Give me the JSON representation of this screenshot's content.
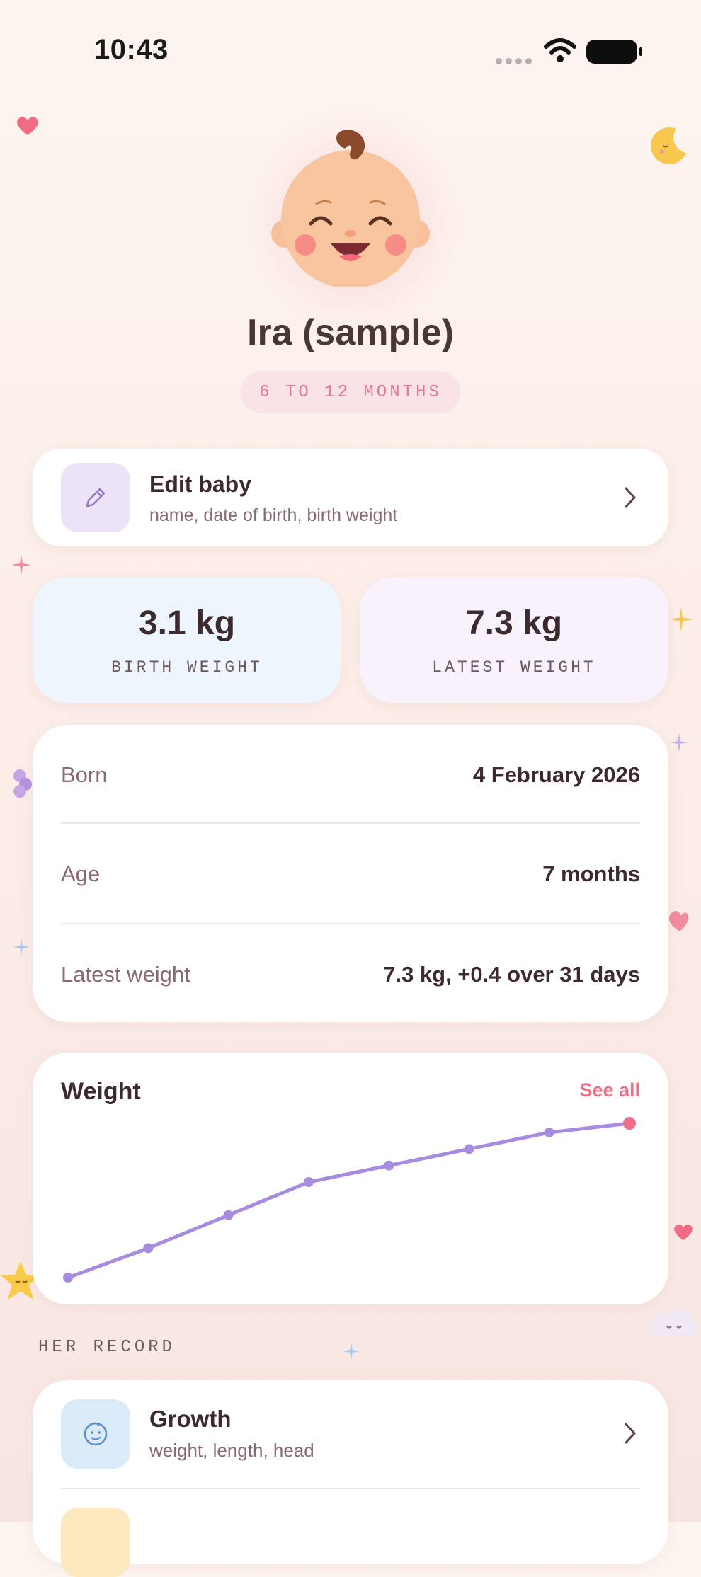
{
  "status_bar": {
    "time": "10:43"
  },
  "profile": {
    "name": "Ira (sample)",
    "age_range": "6 TO 12 MONTHS"
  },
  "edit_baby": {
    "title": "Edit baby",
    "subtitle": "name, date of birth, birth weight"
  },
  "stats": [
    {
      "value": "3.1 kg",
      "label": "BIRTH WEIGHT"
    },
    {
      "value": "7.3 kg",
      "label": "LATEST WEIGHT"
    }
  ],
  "info": {
    "rows": [
      {
        "key": "Born",
        "value": "4 February 2026"
      },
      {
        "key": "Age",
        "value": "7 months"
      },
      {
        "key": "Latest weight",
        "value": "7.3 kg, +0.4 over 31 days"
      }
    ]
  },
  "weight_chart": {
    "title": "Weight",
    "see_all": "See all"
  },
  "chart_data": {
    "type": "line",
    "title": "Weight",
    "xlabel": "",
    "ylabel": "",
    "series": [
      {
        "values": [
          3.1,
          3.9,
          4.8,
          5.7,
          6.15,
          6.6,
          7.05,
          7.3
        ]
      }
    ],
    "ylim": [
      3.1,
      7.3
    ],
    "grid": false,
    "colors": {
      "line": "#a68be0",
      "last_point": "#ef6f88"
    }
  },
  "record": {
    "section_label": "HER RECORD",
    "items": [
      {
        "title": "Growth",
        "subtitle": "weight, length, head"
      }
    ]
  },
  "colors": {
    "accent": "#ee6f86",
    "purple_tile": "#ece3f8",
    "blue_tile": "#dbeaf9",
    "birth_card": "#eef5fd",
    "latest_card": "#f7f2fb"
  }
}
